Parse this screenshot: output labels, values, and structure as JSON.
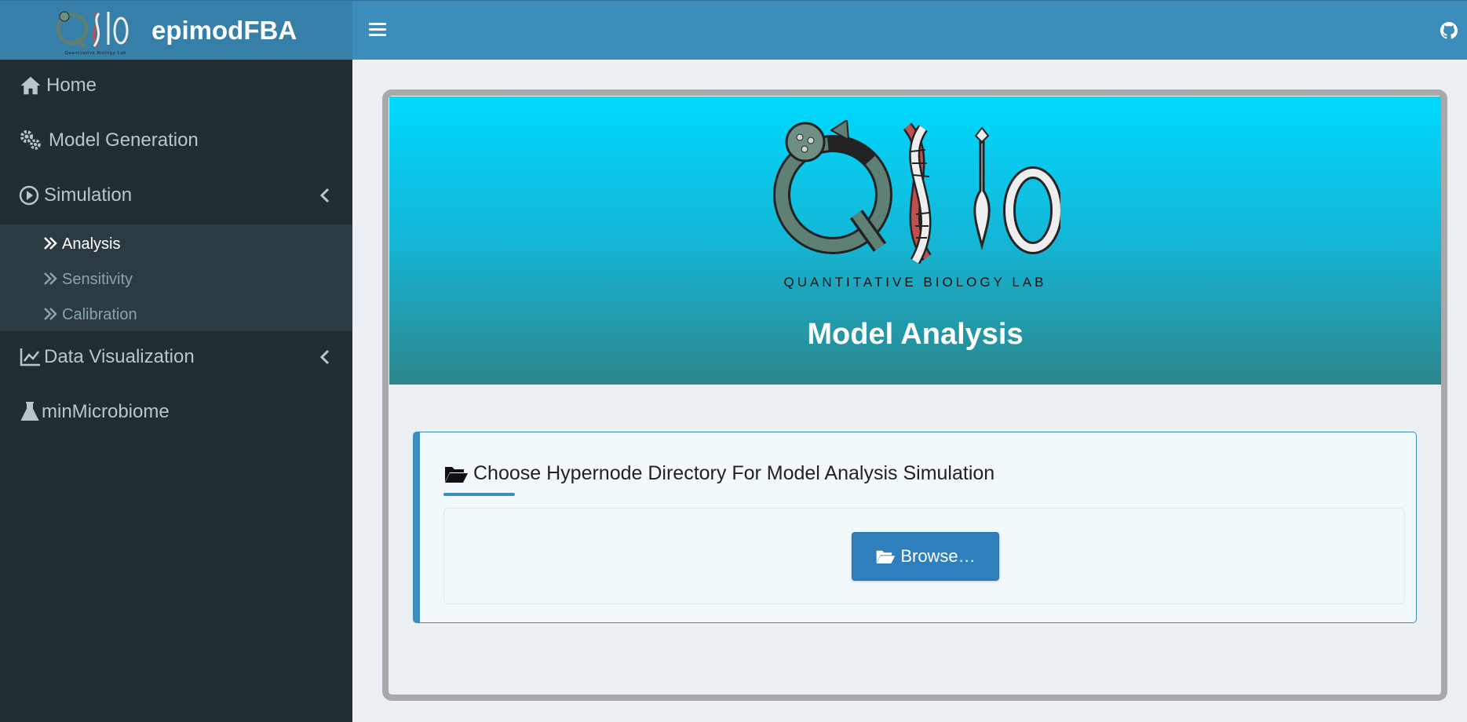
{
  "header": {
    "app_title": "epimodFBA",
    "logo_text": "QBio",
    "logo_caption": "Quantitative Biology Lab",
    "accent_color": "#3c8dbc"
  },
  "sidebar": {
    "items": [
      {
        "label": "Home",
        "icon": "home-icon"
      },
      {
        "label": "Model Generation",
        "icon": "gears-icon"
      },
      {
        "label": "Simulation",
        "icon": "play-circle-icon",
        "expanded": true
      },
      {
        "label": "Data Visualization",
        "icon": "line-chart-icon"
      },
      {
        "label": "minMicrobiome",
        "icon": "flask-icon"
      }
    ],
    "simulation_subitems": [
      {
        "label": "Analysis",
        "active": true
      },
      {
        "label": "Sensitivity"
      },
      {
        "label": "Calibration"
      }
    ]
  },
  "main": {
    "hero_title": "Model Analysis",
    "hero_logo_caption": "QUANTITATIVE BIOLOGY LAB",
    "panel_title": "Choose Hypernode Directory For Model Analysis Simulation",
    "browse_label": "Browse…"
  }
}
